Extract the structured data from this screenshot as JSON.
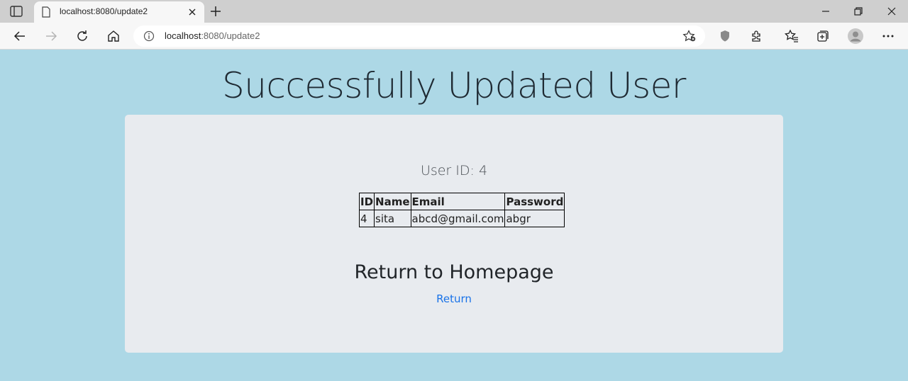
{
  "browser": {
    "tab_title": "localhost:8080/update2",
    "url_host": "localhost",
    "url_path": ":8080/update2",
    "icons": [
      "tab-strip-icon",
      "page-icon",
      "close-icon",
      "new-tab-icon",
      "minimize-icon",
      "restore-icon",
      "close-window-icon",
      "back-icon",
      "forward-icon",
      "refresh-icon",
      "home-icon",
      "info-icon",
      "add-favorite-icon",
      "shield-icon",
      "extensions-icon",
      "favorites-icon",
      "collections-icon",
      "profile-icon",
      "more-icon"
    ]
  },
  "page": {
    "title": "Successfully Updated User",
    "user_id_label": "User ID: 4",
    "table": {
      "headers": [
        "ID",
        "Name",
        "Email",
        "Password"
      ],
      "rows": [
        [
          "4",
          "sita",
          "abcd@gmail.com",
          "abgr"
        ]
      ]
    },
    "return_heading": "Return to Homepage",
    "return_link": "Return"
  },
  "colors": {
    "page_bg": "#add8e6",
    "card_bg": "#e8ebef",
    "link": "#1a73e8"
  }
}
